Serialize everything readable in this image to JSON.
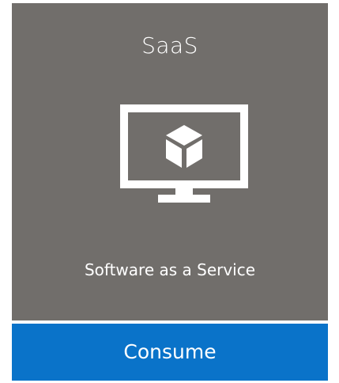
{
  "card": {
    "title": "SaaS",
    "subtitle": "Software as a Service",
    "icon": "monitor-with-cube-icon",
    "background_color": "#716e6b"
  },
  "action": {
    "label": "Consume",
    "background_color": "#0a73c9"
  }
}
